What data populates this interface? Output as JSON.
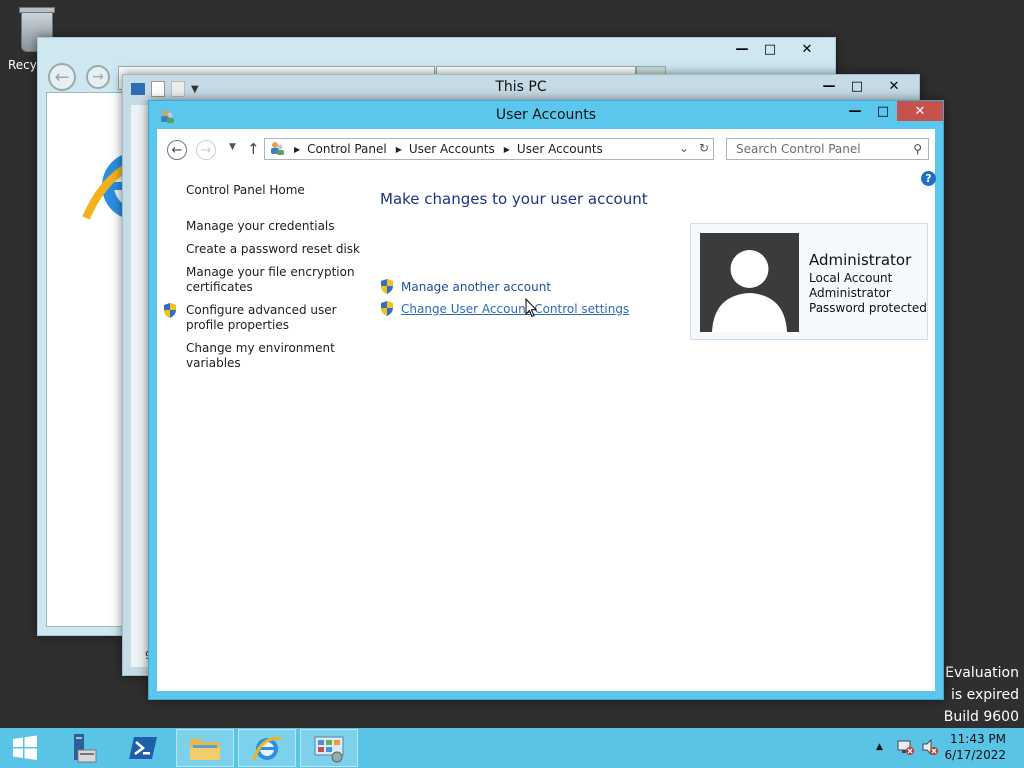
{
  "desktop": {
    "recycle_bin_label": "Recyc",
    "watermark": {
      "line1": "Evaluation",
      "line2": "is expired",
      "line3": "Build 9600"
    }
  },
  "ie_window": {
    "address_partial": "",
    "tab_partial": ""
  },
  "this_pc_window": {
    "title": "This PC",
    "status_partial": "9"
  },
  "user_accounts_window": {
    "title": "User Accounts",
    "breadcrumb": [
      "Control Panel",
      "User Accounts",
      "User Accounts"
    ],
    "search_placeholder": "Search Control Panel",
    "left_nav": {
      "home": "Control Panel Home",
      "manage_credentials": "Manage your credentials",
      "password_reset": "Create a password reset disk",
      "encryption_line1": "Manage your file encryption",
      "encryption_line2": "certificates",
      "advanced_line1": "Configure advanced user",
      "advanced_line2": "profile properties",
      "env_line1": "Change my environment",
      "env_line2": "variables"
    },
    "heading": "Make changes to your user account",
    "tasks": {
      "manage_another": "Manage another account",
      "uac_settings": "Change User Account Control settings"
    },
    "account": {
      "name": "Administrator",
      "type": "Local Account",
      "group": "Administrator",
      "status": "Password protected"
    }
  },
  "taskbar": {
    "time": "11:43 PM",
    "date": "6/17/2022"
  },
  "colors": {
    "taskbar": "#5ac4e6",
    "active_caption": "#5cc7ec",
    "link": "#1f4f9a",
    "heading": "#1e3287",
    "close_button": "#c7514b"
  }
}
